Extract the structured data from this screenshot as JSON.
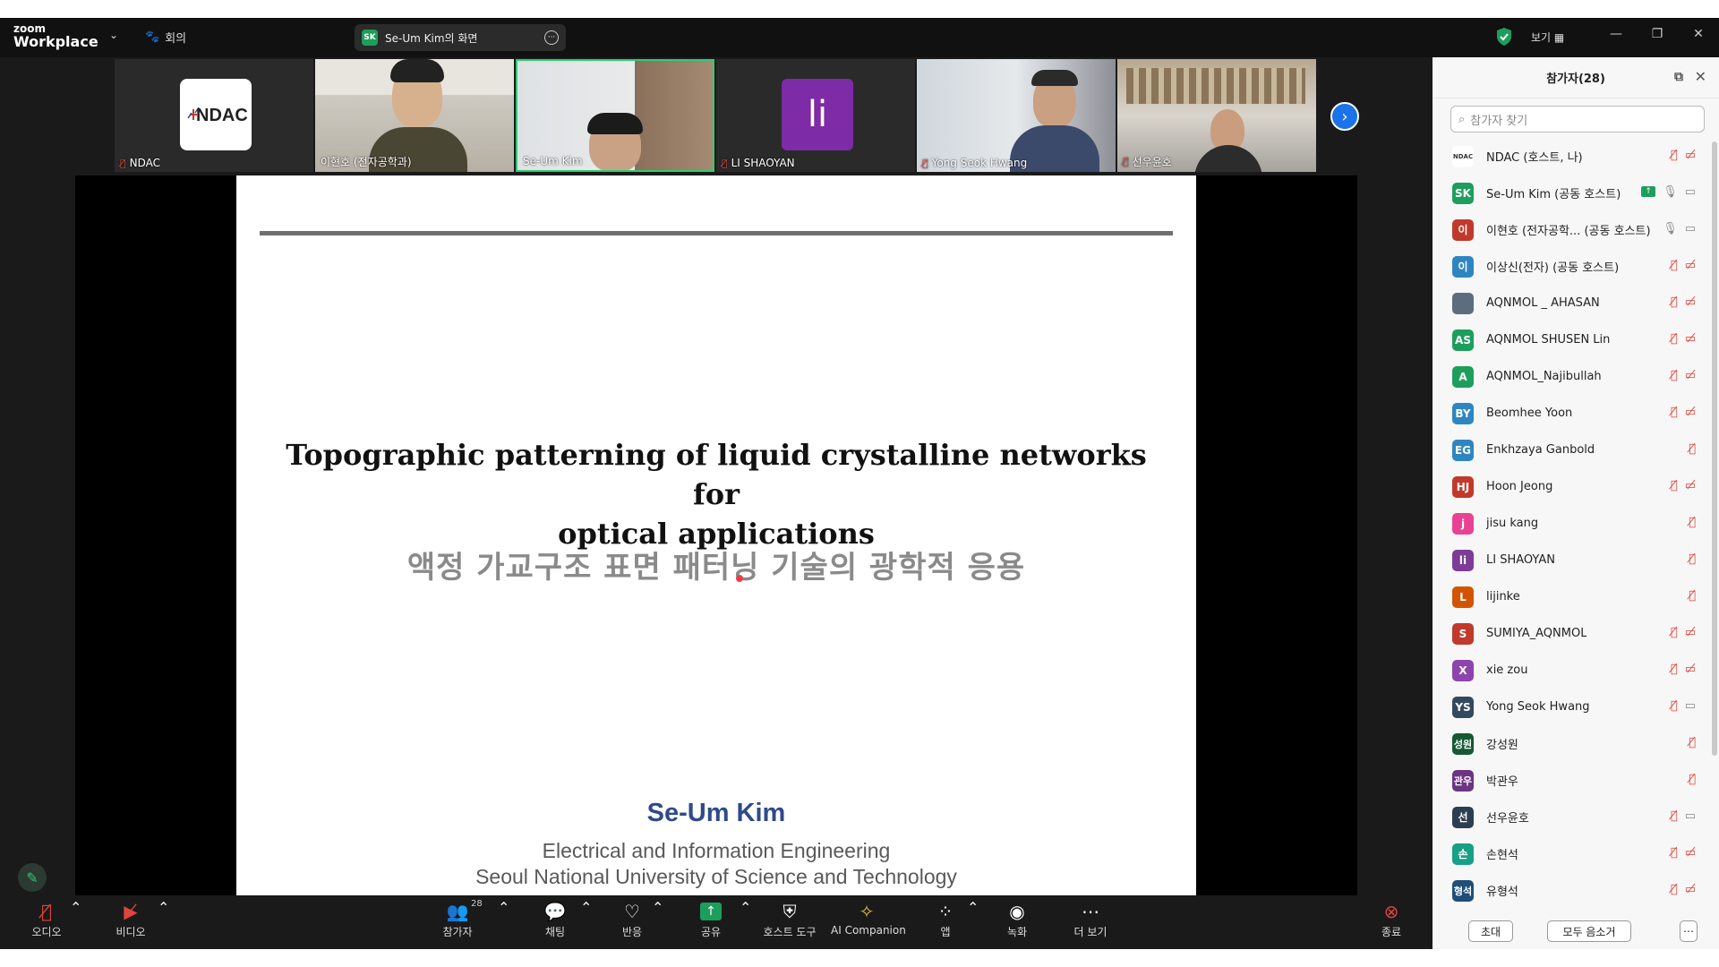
{
  "app": {
    "logo_top": "zoom",
    "logo_bottom": "Workplace",
    "meeting_label": "회의",
    "share_indicator": "Se-Um Kim의 화면",
    "share_badge": "SK",
    "view_label": "보기",
    "accent": "#1e9e5c"
  },
  "videos": [
    {
      "name": "NDAC",
      "muted": true,
      "logo_text": "NDAC"
    },
    {
      "name": "이현호 (전자공학과)",
      "muted": false
    },
    {
      "name": "Se-Um Kim",
      "muted": false,
      "active_speaker": true
    },
    {
      "name": "LI SHAOYAN",
      "muted": true,
      "avatar": "li"
    },
    {
      "name": "Yong Seok Hwang",
      "muted": true
    },
    {
      "name": "선우윤호",
      "muted": true
    }
  ],
  "slide": {
    "title_line1": "Topographic patterning of liquid crystalline networks for",
    "title_line2": "optical applications",
    "korean_title": "액정 가교구조 표면 패터닝 기술의 광학적 응용",
    "author": "Se-Um Kim",
    "department": "Electrical and Information Engineering",
    "university": "Seoul National University of Science and Technology"
  },
  "toolbar": {
    "audio": "오디오",
    "video": "비디오",
    "participants": "참가자",
    "participants_count": "28",
    "chat": "채팅",
    "react": "반응",
    "share": "공유",
    "host_tools": "호스트 도구",
    "ai_companion": "AI Companion",
    "apps": "앱",
    "record": "녹화",
    "more": "더 보기",
    "end": "종료"
  },
  "panel": {
    "title": "참가자(28)",
    "search_placeholder": "참가자 찾기",
    "invite": "초대",
    "mute_all": "모두 음소거",
    "participants": [
      {
        "name": "NDAC (호스트, 나)",
        "initials": "NDAC",
        "color": "#ffffff",
        "mic": "off",
        "video": "off"
      },
      {
        "name": "Se-Um Kim (공동 호스트)",
        "initials": "SK",
        "color": "#1e9e5c",
        "mic": "on",
        "video": "on",
        "sharing": true
      },
      {
        "name": "이현호 (전자공학... (공동 호스트)",
        "initials": "이",
        "color": "#c0392b",
        "mic": "on",
        "video": "on"
      },
      {
        "name": "이상신(전자) (공동 호스트)",
        "initials": "이",
        "color": "#2e86c1",
        "mic": "off",
        "video": "off"
      },
      {
        "name": "AQNMOL _ AHASAN",
        "initials": "",
        "color": "#5d6d7e",
        "mic": "off",
        "video": "off"
      },
      {
        "name": "AQNMOL SHUSEN Lin",
        "initials": "AS",
        "color": "#1e9e5c",
        "mic": "off",
        "video": "off"
      },
      {
        "name": "AQNMOL_Najibullah",
        "initials": "A",
        "color": "#1e9e5c",
        "mic": "off",
        "video": "off"
      },
      {
        "name": "Beomhee Yoon",
        "initials": "BY",
        "color": "#2e86c1",
        "mic": "off",
        "video": "off"
      },
      {
        "name": "Enkhzaya Ganbold",
        "initials": "EG",
        "color": "#2e86c1",
        "mic": "off",
        "video": "none"
      },
      {
        "name": "Hoon Jeong",
        "initials": "HJ",
        "color": "#c0392b",
        "mic": "off",
        "video": "off"
      },
      {
        "name": "jisu kang",
        "initials": "j",
        "color": "#e84393",
        "mic": "off",
        "video": "none"
      },
      {
        "name": "LI SHAOYAN",
        "initials": "li",
        "color": "#7d3c98",
        "mic": "off",
        "video": "none"
      },
      {
        "name": "lijinke",
        "initials": "L",
        "color": "#d35400",
        "mic": "off",
        "video": "none"
      },
      {
        "name": "SUMIYA_AQNMOL",
        "initials": "S",
        "color": "#c0392b",
        "mic": "off",
        "video": "off"
      },
      {
        "name": "xie zou",
        "initials": "X",
        "color": "#8e44ad",
        "mic": "off",
        "video": "off"
      },
      {
        "name": "Yong Seok Hwang",
        "initials": "YS",
        "color": "#34495e",
        "mic": "off",
        "video": "on"
      },
      {
        "name": "강성원",
        "initials": "성원",
        "color": "#145a32",
        "mic": "off",
        "video": "none"
      },
      {
        "name": "박관우",
        "initials": "관우",
        "color": "#6c3483",
        "mic": "off",
        "video": "none"
      },
      {
        "name": "선우윤호",
        "initials": "선",
        "color": "#2c3e50",
        "mic": "off",
        "video": "on"
      },
      {
        "name": "손현석",
        "initials": "손",
        "color": "#16a085",
        "mic": "off",
        "video": "off"
      },
      {
        "name": "유형석",
        "initials": "형석",
        "color": "#1f4e79",
        "mic": "off",
        "video": "off"
      }
    ]
  }
}
